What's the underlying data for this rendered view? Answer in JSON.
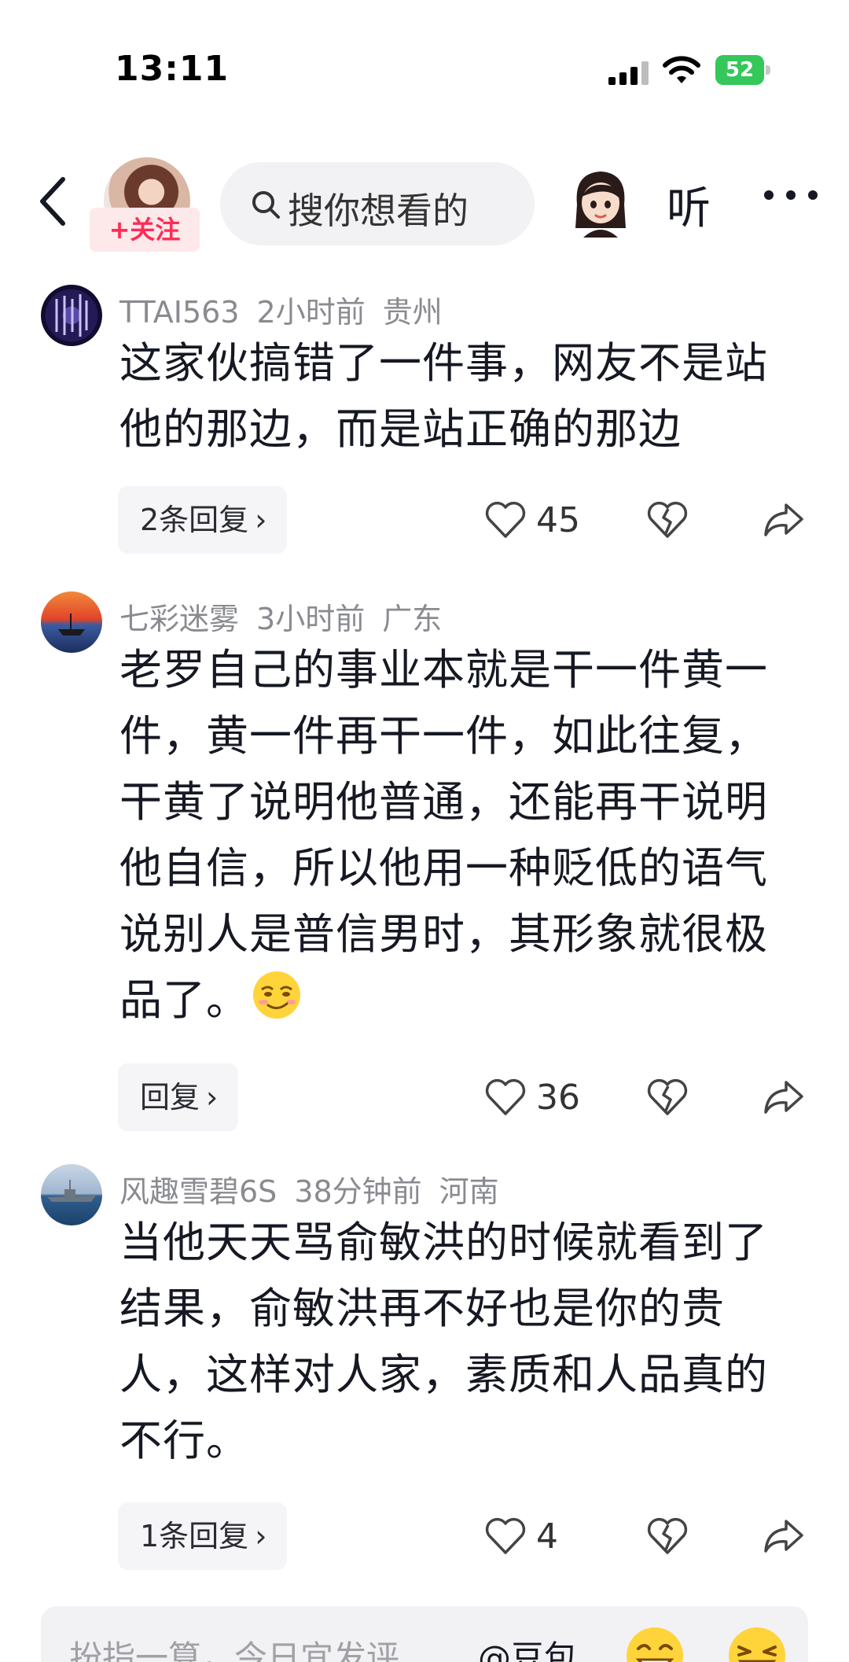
{
  "status": {
    "time": "13:11",
    "battery": "52"
  },
  "header": {
    "follow_label": "+关注",
    "search_placeholder": "搜你想看的",
    "listen_label": "听"
  },
  "comments": [
    {
      "user": "TTAI563",
      "time": "2小时前",
      "location": "贵州",
      "text": "这家伙搞错了一件事，网友不是站他的那边，而是站正确的那边",
      "reply_label": "2条回复",
      "likes": "45"
    },
    {
      "user": "七彩迷雾",
      "time": "3小时前",
      "location": "广东",
      "text": "老罗自己的事业本就是干一件黄一件，黄一件再干一件，如此往复，干黄了说明他普通，还能再干说明他自信，所以他用一种贬低的语气说别人是普信男时，其形象就很极品了。",
      "reply_label": "回复",
      "likes": "36"
    },
    {
      "user": "风趣雪碧6S",
      "time": "38分钟前",
      "location": "河南",
      "text": "当他天天骂俞敏洪的时候就看到了结果，俞敏洪再不好也是你的贵人，这样对人家，素质和人品真的不行。",
      "reply_label": "1条回复",
      "likes": "4"
    }
  ],
  "bottom": {
    "placeholder": "扮指一算，今日宜发评",
    "mention": "@豆包"
  },
  "colors": {
    "accent": "#fe2c55",
    "battery": "#34c759"
  },
  "icons": [
    "back-arrow-icon",
    "search-icon",
    "more-icon",
    "heart-icon",
    "broken-heart-icon",
    "share-icon",
    "chevron-right-icon",
    "smirk-emoji-icon",
    "grin-emoji-icon",
    "laugh-emoji-icon"
  ]
}
